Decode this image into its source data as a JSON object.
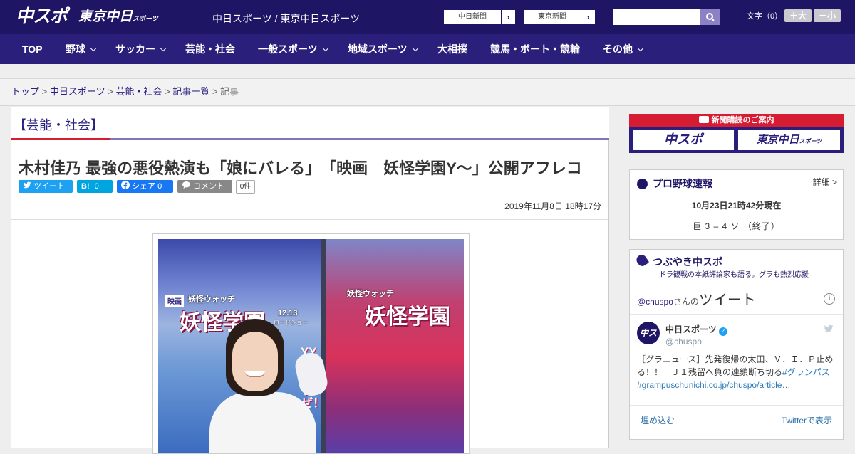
{
  "header": {
    "logo_main": "中スポ",
    "logo_tokyo": "東京中日",
    "logo_tokyo_sub": "スポーツ",
    "site_title": "中日スポーツ / 東京中日スポーツ",
    "newspaper_links": [
      "中日新聞",
      "東京新聞"
    ],
    "search_placeholder": "",
    "font_size_label": "文字（0）",
    "font_larger": "＋大",
    "font_smaller": "－小"
  },
  "nav": {
    "items": [
      {
        "label": "TOP",
        "has_menu": false
      },
      {
        "label": "野球",
        "has_menu": true
      },
      {
        "label": "サッカー",
        "has_menu": true
      },
      {
        "label": "芸能・社会",
        "has_menu": false
      },
      {
        "label": "一般スポーツ",
        "has_menu": true
      },
      {
        "label": "地域スポーツ",
        "has_menu": true
      },
      {
        "label": "大相撲",
        "has_menu": false
      },
      {
        "label": "競馬・ボート・競輪",
        "has_menu": false
      },
      {
        "label": "その他",
        "has_menu": true
      }
    ]
  },
  "breadcrumb": {
    "items": [
      "トップ",
      "中日スポーツ",
      "芸能・社会",
      "記事一覧"
    ],
    "current": "記事",
    "separator": ">"
  },
  "article": {
    "category": "【芸能・社会】",
    "headline": "木村佳乃 最強の悪役熱演も「娘にバレる」　「映画　妖怪学園Y～」公開アフレコ",
    "share": {
      "tweet": "ツイート",
      "hatena": "B!",
      "hatena_count": "0",
      "facebook": "シェア",
      "facebook_count": "0",
      "comment": "コメント",
      "comment_count": "0件"
    },
    "published": "2019年11月8日 18時17分",
    "photo_poster_text": [
      "映画",
      "妖怪ウォッチ",
      "妖怪学園",
      "12.13",
      "ロードショー",
      "YYやろうぜ！"
    ]
  },
  "sidebar": {
    "subscribe": {
      "title": "新聞購読のご案内",
      "logos": [
        "中スポ",
        "東京中日"
      ],
      "logo_sub": "スポーツ"
    },
    "baseball": {
      "title": "プロ野球速報",
      "detail_link": "詳細 >",
      "timestamp": "10月23日21時42分現在",
      "score": "巨 3 – 4 ソ （終了）"
    },
    "tsubuyaki": {
      "title": "つぶやき中スポ",
      "subtitle": "ドラ観戦の本紙評論家も語る。グラも熱烈応援",
      "widget_handle": "@chuspo",
      "widget_suffix": "さんの",
      "widget_title": "ツイート",
      "tweet_author": "中日スポーツ",
      "tweet_handle": "@chuspo",
      "tweet_text": "［グラニュース］先発復帰の太田、Ｖ．Ｉ．Ｐ止める！！　Ｊ１残留へ負の連鎖断ち切る",
      "tweet_hashtag": "#グランパス",
      "tweet_link": "#grampuschunichi.co.jp/chuspo/article…",
      "embed_label": "埋め込む",
      "view_on_twitter": "Twitterで表示"
    }
  },
  "colors": {
    "brand_navy": "#1e1564",
    "nav_purple": "#2a1f7a",
    "accent_red": "#d51c33",
    "link": "#2a2080",
    "twitter": "#1da1f2",
    "hatena": "#00a4de",
    "facebook": "#1877f2"
  }
}
